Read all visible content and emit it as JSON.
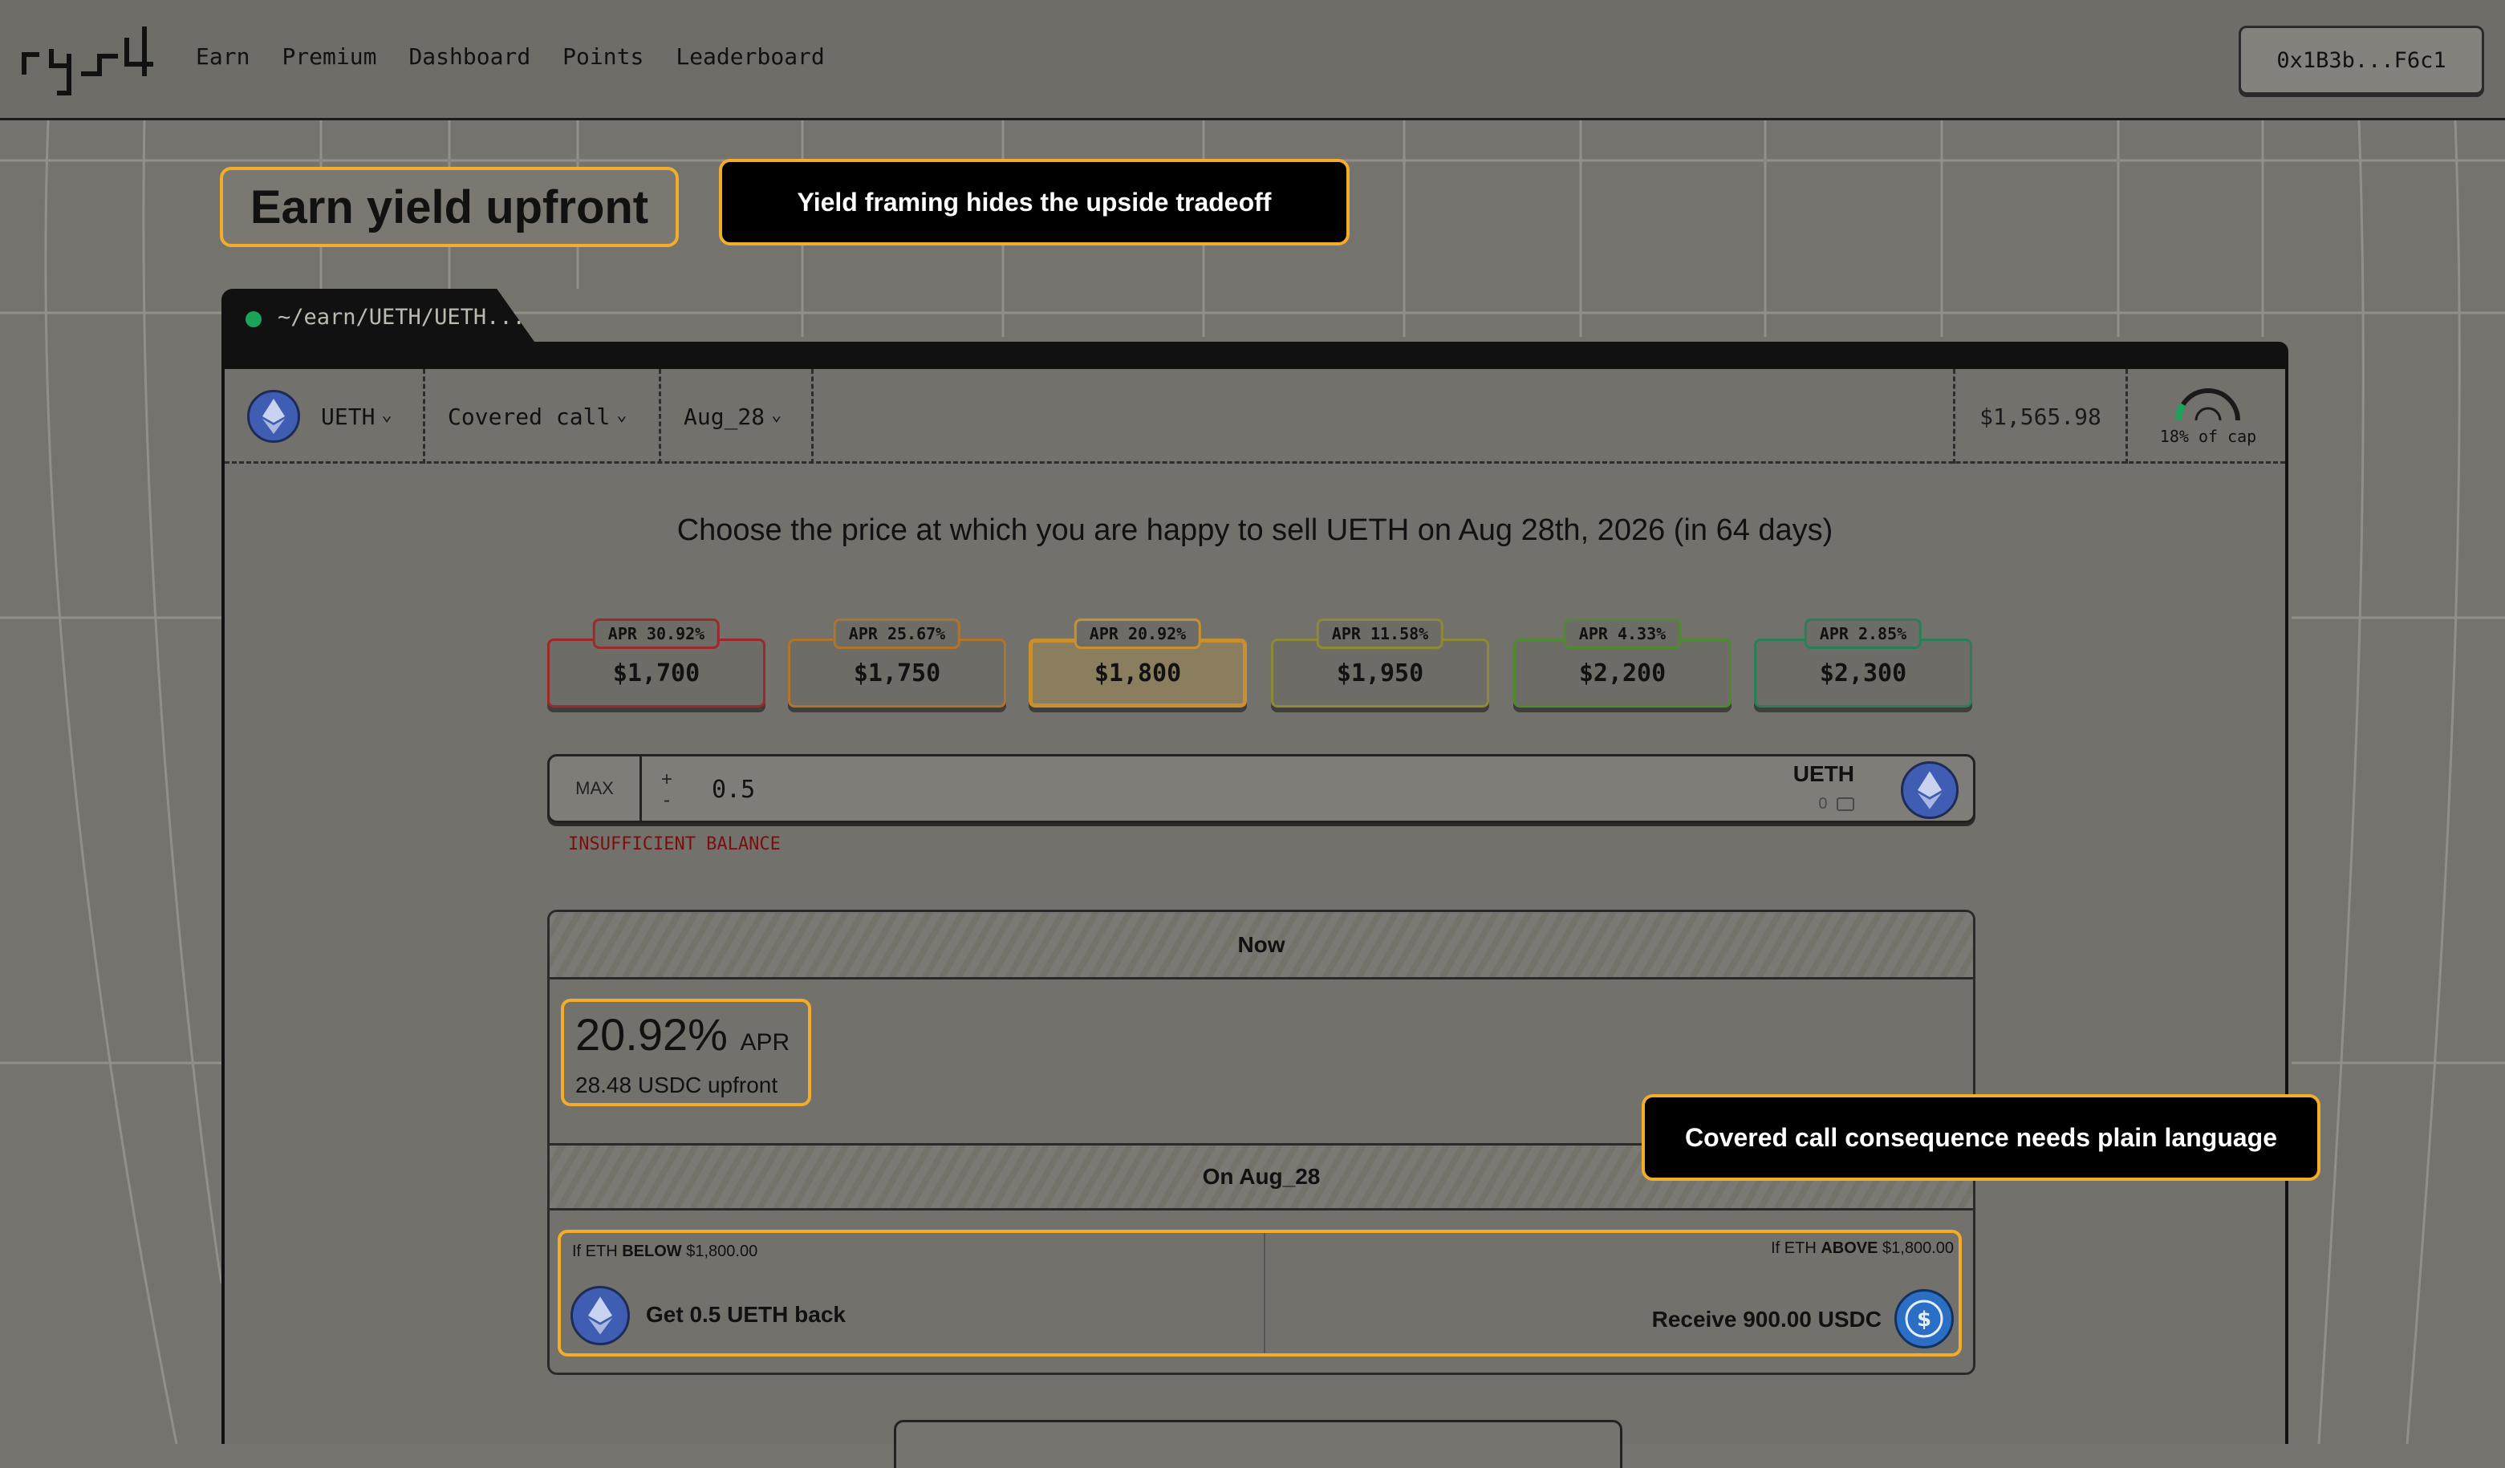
{
  "nav": {
    "links": [
      "Earn",
      "Premium",
      "Dashboard",
      "Points",
      "Leaderboard"
    ],
    "wallet": "0x1B3b...F6c1"
  },
  "annotations": {
    "title": "Earn yield upfront",
    "yield_callout": "Yield framing hides the upside tradeoff",
    "covered_callout": "Covered call consequence needs plain language"
  },
  "tab": {
    "path": "~/earn/UETH/UETH..."
  },
  "toolbar": {
    "asset": "UETH",
    "strategy": "Covered call",
    "expiry": "Aug_28",
    "price": "$1,565.98",
    "cap_label": "18% of cap",
    "cap_fraction": 0.18
  },
  "prompt": "Choose the price at which you are happy to sell UETH on Aug 28th, 2026 (in 64 days)",
  "strikes": [
    {
      "apr_label": "APR",
      "apr": "30.92%",
      "price": "$1,700",
      "color": "#9c2a2a"
    },
    {
      "apr_label": "APR",
      "apr": "25.67%",
      "price": "$1,750",
      "color": "#b0742a"
    },
    {
      "apr_label": "APR",
      "apr": "20.92%",
      "price": "$1,800",
      "color": "#c8902f",
      "selected": true
    },
    {
      "apr_label": "APR",
      "apr": "11.58%",
      "price": "$1,950",
      "color": "#8c8a34"
    },
    {
      "apr_label": "APR",
      "apr": "4.33%",
      "price": "$2,200",
      "color": "#4e8a2e"
    },
    {
      "apr_label": "APR",
      "apr": "2.85%",
      "price": "$2,300",
      "color": "#2a7f57"
    }
  ],
  "amount": {
    "max_label": "MAX",
    "plus": "+",
    "minus": "-",
    "value": "0.5",
    "token": "UETH",
    "balance": "0",
    "error": "INSUFFICIENT BALANCE"
  },
  "summary": {
    "now_label": "Now",
    "apr_value": "20.92%",
    "apr_suffix": "APR",
    "upfront": "28.48 USDC upfront",
    "on_label": "On Aug_28",
    "below_prefix": "If ETH",
    "below_word": "BELOW",
    "below_price": "$1,800.00",
    "below_action": "Get 0.5 UETH back",
    "above_prefix": "If ETH",
    "above_word": "ABOVE",
    "above_price": "$1,800.00",
    "above_action": "Receive 900.00 USDC"
  },
  "colors": {
    "accent_outline": "#f3ad2a",
    "error": "#7a0f0f",
    "status_dot": "#1aa359"
  }
}
